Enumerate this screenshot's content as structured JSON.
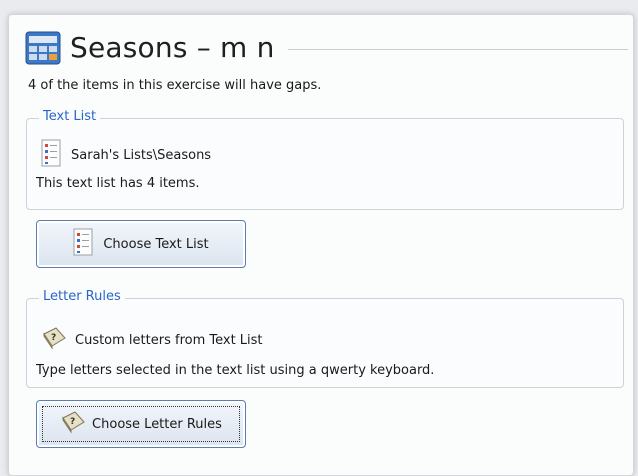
{
  "window": {
    "title": "Seasons – m n",
    "intro": "4 of the items in this exercise will have gaps."
  },
  "text_list": {
    "group_label": "Text List",
    "item_name": "Sarah's Lists\\Seasons",
    "item_icon": "text-list-icon",
    "description": "This text list has 4 items.",
    "button_label": "Choose Text List"
  },
  "letter_rules": {
    "group_label": "Letter Rules",
    "item_name": "Custom letters from Text List",
    "item_icon": "letter-rules-icon",
    "description": "Type letters selected in the text list using a qwerty keyboard.",
    "button_label": "Choose Letter Rules"
  },
  "colors": {
    "group_label": "#2a66c8",
    "button_border": "#5d7fb0"
  }
}
